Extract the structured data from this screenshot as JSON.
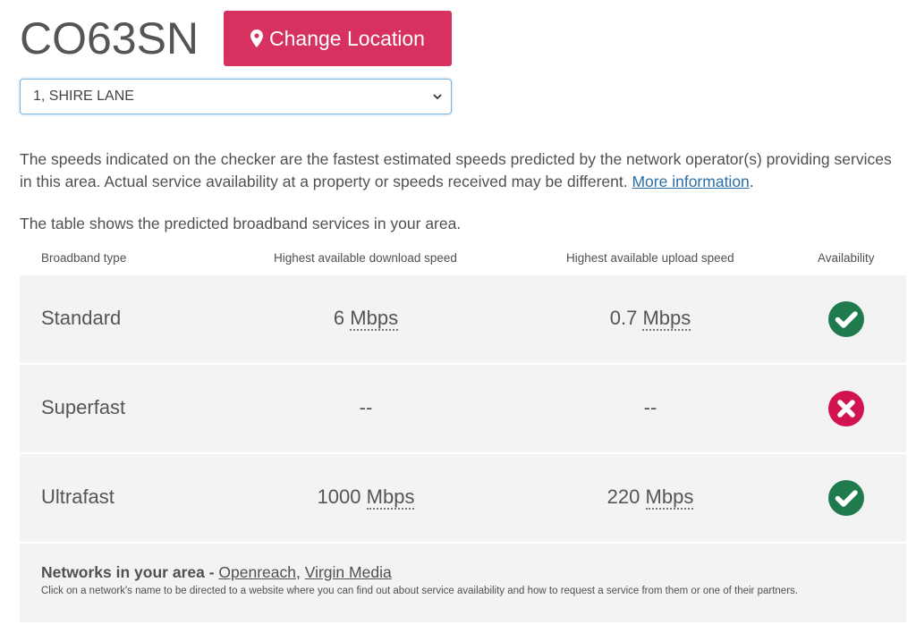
{
  "header": {
    "postcode": "CO63SN",
    "change_location_label": "Change Location",
    "address_selected": "1, SHIRE LANE"
  },
  "intro": {
    "paragraph": "The speeds indicated on the checker are the fastest estimated speeds predicted by the network operator(s) providing services in this area. Actual service availability at a property or speeds received may be different. ",
    "more_info_link": "More information",
    "paragraph_end": ".",
    "table_intro": "The table shows the predicted broadband services in your area."
  },
  "table": {
    "headers": [
      "Broadband type",
      "Highest available download speed",
      "Highest available upload speed",
      "Availability"
    ],
    "rows": [
      {
        "type": "Standard",
        "download_value": "6",
        "download_unit": "Mbps",
        "upload_value": "0.7",
        "upload_unit": "Mbps",
        "available": true
      },
      {
        "type": "Superfast",
        "download_value": "--",
        "download_unit": "",
        "upload_value": "--",
        "upload_unit": "",
        "available": false
      },
      {
        "type": "Ultrafast",
        "download_value": "1000",
        "download_unit": "Mbps",
        "upload_value": "220",
        "upload_unit": "Mbps",
        "available": true
      }
    ]
  },
  "networks": {
    "title": "Networks in your area - ",
    "links": [
      "Openreach",
      "Virgin Media"
    ],
    "separator": ", ",
    "note": "Click on a network's name to be directed to a website where you can find out about service availability and how to request a service from them or one of their partners."
  },
  "colors": {
    "brand": "#d6315f",
    "available": "#1f7a4d",
    "unavailable": "#d1134f",
    "link": "#2a6fa8"
  }
}
